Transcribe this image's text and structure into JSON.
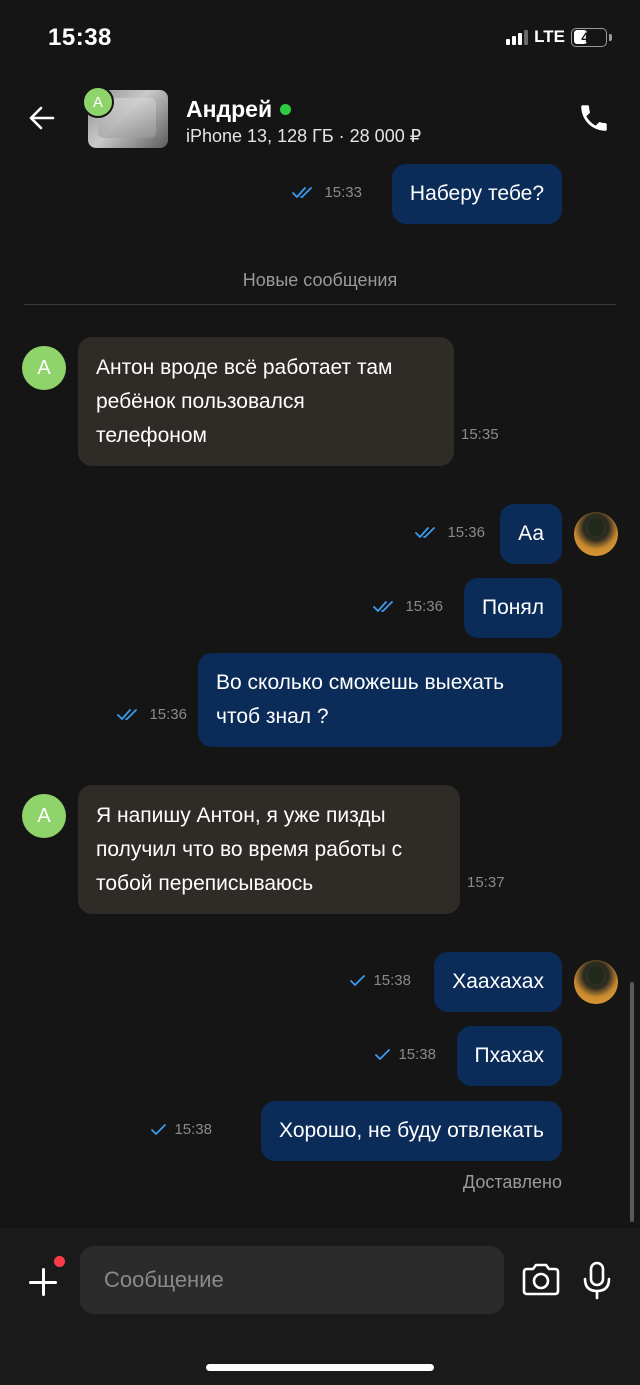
{
  "status_bar": {
    "time": "15:38",
    "network": "LTE",
    "battery": "45",
    "battery_level": 0.45
  },
  "header": {
    "avatar_letter": "A",
    "contact_name": "Андрей",
    "listing": "iPhone 13, 128 ГБ · 28 000 ₽"
  },
  "divider": {
    "label": "Новые сообщения"
  },
  "messages": [
    {
      "direction": "out",
      "lines": [
        "Наберу тебе?"
      ],
      "time": "15:33",
      "status": "read"
    },
    {
      "direction": "in",
      "lines": [
        "Антон вроде всё работает там",
        "ребёнок пользовался",
        "телефоном"
      ],
      "time": "15:35",
      "avatar_letter": "A"
    },
    {
      "direction": "out",
      "lines": [
        "Аа"
      ],
      "time": "15:36",
      "status": "read"
    },
    {
      "direction": "out",
      "lines": [
        "Понял"
      ],
      "time": "15:36",
      "status": "read"
    },
    {
      "direction": "out",
      "lines": [
        "Во сколько сможешь выехать",
        "чтоб знал ?"
      ],
      "time": "15:36",
      "status": "read"
    },
    {
      "direction": "in",
      "lines": [
        "Я напишу Антон, я уже пизды",
        "получил что во время работы с",
        "тобой переписываюсь"
      ],
      "time": "15:37",
      "avatar_letter": "A"
    },
    {
      "direction": "out",
      "lines": [
        "Хаахахах"
      ],
      "time": "15:38",
      "status": "sent"
    },
    {
      "direction": "out",
      "lines": [
        "Пхахах"
      ],
      "time": "15:38",
      "status": "sent"
    },
    {
      "direction": "out",
      "lines": [
        "Хорошо, не буду отвлекать"
      ],
      "time": "15:38",
      "status": "sent"
    }
  ],
  "delivery_status": "Доставлено",
  "composer": {
    "placeholder": "Сообщение"
  },
  "colors": {
    "background": "#151515",
    "outgoing_bubble": "#0b2c59",
    "incoming_bubble": "#2f2b26",
    "check": "#3b9bf0",
    "online": "#2ecc40",
    "avatar": "#8fd46b",
    "notification_dot": "#ff3b4a"
  },
  "icons": {
    "back": "arrow-left-icon",
    "call": "phone-icon",
    "add": "plus-icon",
    "camera": "camera-icon",
    "mic": "microphone-icon",
    "read": "double-check-icon",
    "sent": "single-check-icon"
  }
}
